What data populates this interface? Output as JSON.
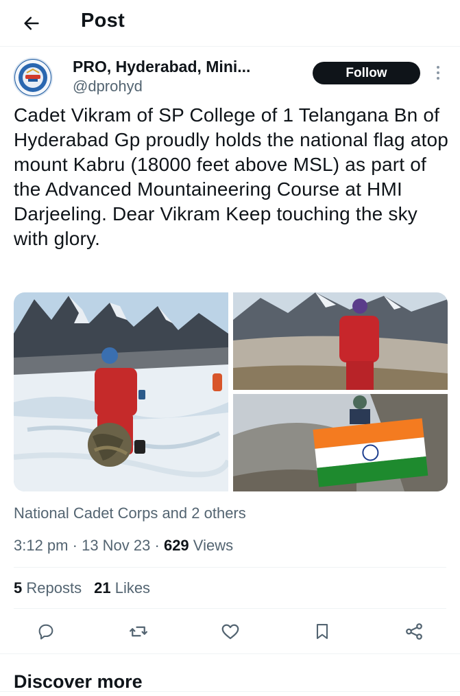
{
  "header": {
    "title": "Post",
    "back_icon": "arrow-left-icon"
  },
  "author": {
    "display_name": "PRO, Hyderabad, Mini...",
    "handle": "@dprohyd",
    "follow_label": "Follow",
    "more_icon": "vertical-dots-icon"
  },
  "post": {
    "text": "Cadet Vikram of SP College of 1 Telangana Bn of Hyderabad Gp proudly holds the national flag atop mount Kabru (18000 feet above MSL) as part of the Advanced Mountaineering Course at HMI Darjeeling. Dear Vikram Keep touching the sky with glory.",
    "tagged": "National Cadet Corps and 2 others",
    "time": "3:12 pm",
    "date": "13 Nov 23",
    "views_count": "629",
    "views_label": "Views",
    "separator": "·"
  },
  "stats": {
    "reposts_count": "5",
    "reposts_label": "Reposts",
    "likes_count": "21",
    "likes_label": "Likes"
  },
  "actions": [
    "reply-icon",
    "repost-icon",
    "like-icon",
    "bookmark-icon",
    "share-icon"
  ],
  "discover": {
    "title": "Discover more"
  },
  "colors": {
    "text": "#0f1419",
    "secondary": "#536471",
    "follow_bg": "#0f1419",
    "divider": "#eff3f4"
  }
}
